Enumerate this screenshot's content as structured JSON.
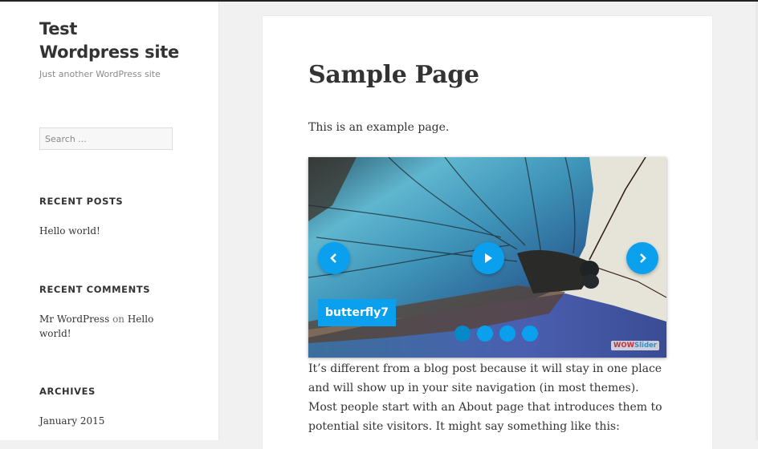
{
  "site": {
    "title_line1": "Test",
    "title_line2": "Wordpress site",
    "tagline": "Just another WordPress site"
  },
  "search": {
    "placeholder": "Search ..."
  },
  "widgets": {
    "recent_posts": {
      "title": "RECENT POSTS",
      "items": [
        "Hello world!"
      ]
    },
    "recent_comments": {
      "title": "RECENT COMMENTS",
      "items": [
        {
          "author": "Mr WordPress",
          "connector": "on",
          "post": "Hello world!"
        }
      ]
    },
    "archives": {
      "title": "ARCHIVES",
      "items": [
        "January 2015"
      ]
    }
  },
  "page": {
    "title": "Sample Page",
    "intro": "This is an example page.",
    "body": "It’s different from a blog post because it will stay in one place and will show up in your site navigation (in most themes). Most people start with an About page that introduces them to potential site visitors. It might say something like this:"
  },
  "slider": {
    "caption": "butterfly7",
    "slide_count": 4,
    "active_slide": 1,
    "brand_part1": "WOW",
    "brand_part2": "Slider",
    "accent_color": "#0aa0ee",
    "icons": {
      "prev": "chevron-left-icon",
      "play": "play-icon",
      "next": "chevron-right-icon"
    }
  }
}
